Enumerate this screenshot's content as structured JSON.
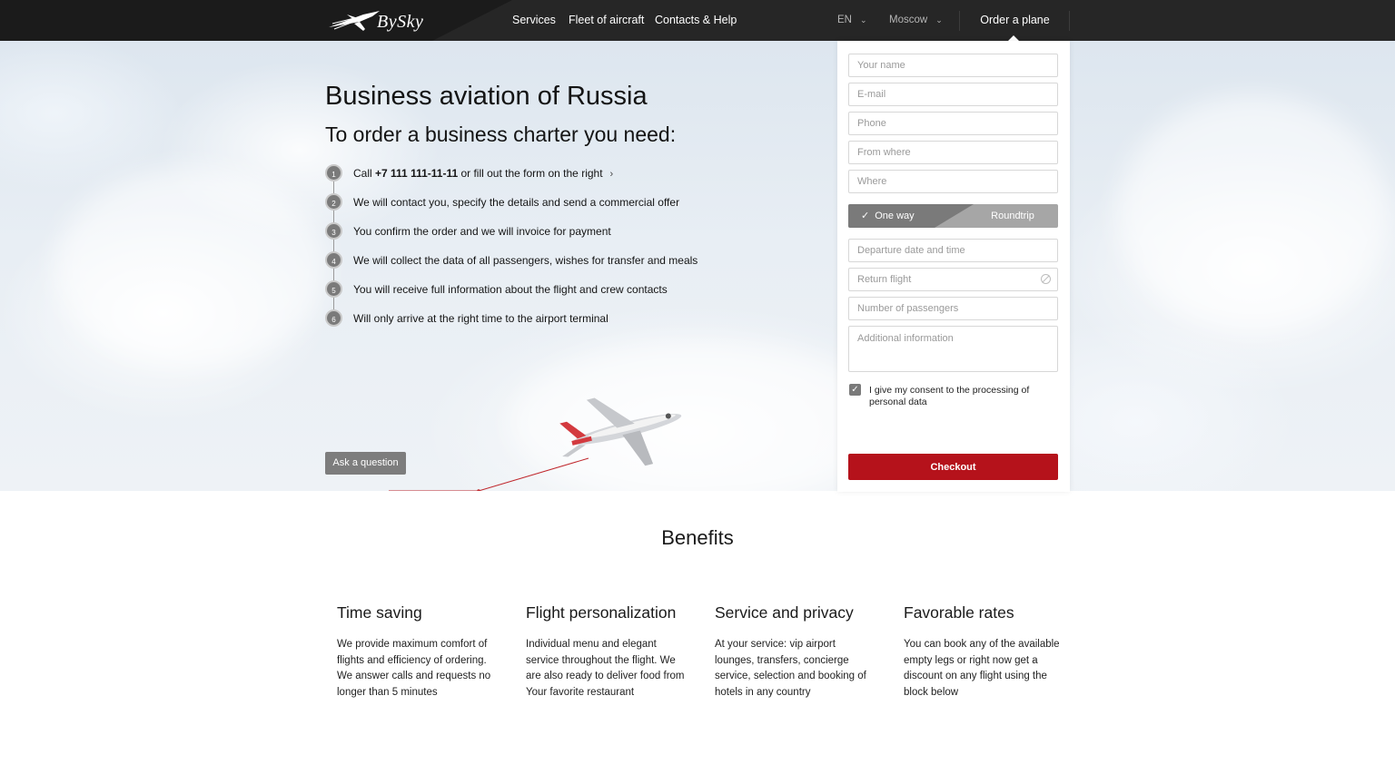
{
  "header": {
    "logo_text": "BySky",
    "nav": [
      "Services",
      "Fleet of aircraft",
      "Contacts & Help"
    ],
    "language": "EN",
    "city": "Moscow",
    "order_label": "Order a plane"
  },
  "hero": {
    "title": "Business aviation of Russia",
    "subtitle": "To order a business charter you need:",
    "steps": [
      {
        "num": "1",
        "pre": "Call ",
        "bold": "+7 111 111-11-11",
        "post": " or fill out the form on the right"
      },
      {
        "num": "2",
        "text": "We will contact you, specify the details and send a commercial offer"
      },
      {
        "num": "3",
        "text": "You confirm the order and we will invoice for payment"
      },
      {
        "num": "4",
        "text": "We will collect the data of all passengers, wishes for transfer and meals"
      },
      {
        "num": "5",
        "text": "You will receive full information about the flight and crew contacts"
      },
      {
        "num": "6",
        "text": "Will only arrive at the right time to the airport terminal"
      }
    ],
    "ask_label": "Ask a question"
  },
  "form": {
    "name_placeholder": "Your name",
    "email_placeholder": "E-mail",
    "phone_placeholder": "Phone",
    "from_placeholder": "From where",
    "where_placeholder": "Where",
    "trip_options": [
      "One way",
      "Roundtrip"
    ],
    "trip_selected": "One way",
    "departure_placeholder": "Departure date and time",
    "return_placeholder": "Return flight",
    "passengers_placeholder": "Number of passengers",
    "additional_placeholder": "Additional information",
    "consent_text": "I give my consent to the processing of personal data",
    "consent_checked": true,
    "checkout_label": "Checkout"
  },
  "benefits": {
    "title": "Benefits",
    "items": [
      {
        "title": "Time saving",
        "text": "We provide maximum comfort of flights and efficiency of ordering. We answer calls and requests no longer than 5 minutes"
      },
      {
        "title": "Flight personalization",
        "text": "Individual menu and elegant service throughout the flight. We are also ready to deliver food from Your favorite restaurant"
      },
      {
        "title": "Service and privacy",
        "text": "At your service: vip airport lounges, transfers, concierge service, selection and booking of hotels in any country"
      },
      {
        "title": "Favorable rates",
        "text": "You can book any of the available empty legs or right now get a discount on any flight using the block below"
      }
    ]
  },
  "colors": {
    "topbar": "#262626",
    "accent_red": "#b5121b",
    "step_badge": "#7a7a7a"
  }
}
